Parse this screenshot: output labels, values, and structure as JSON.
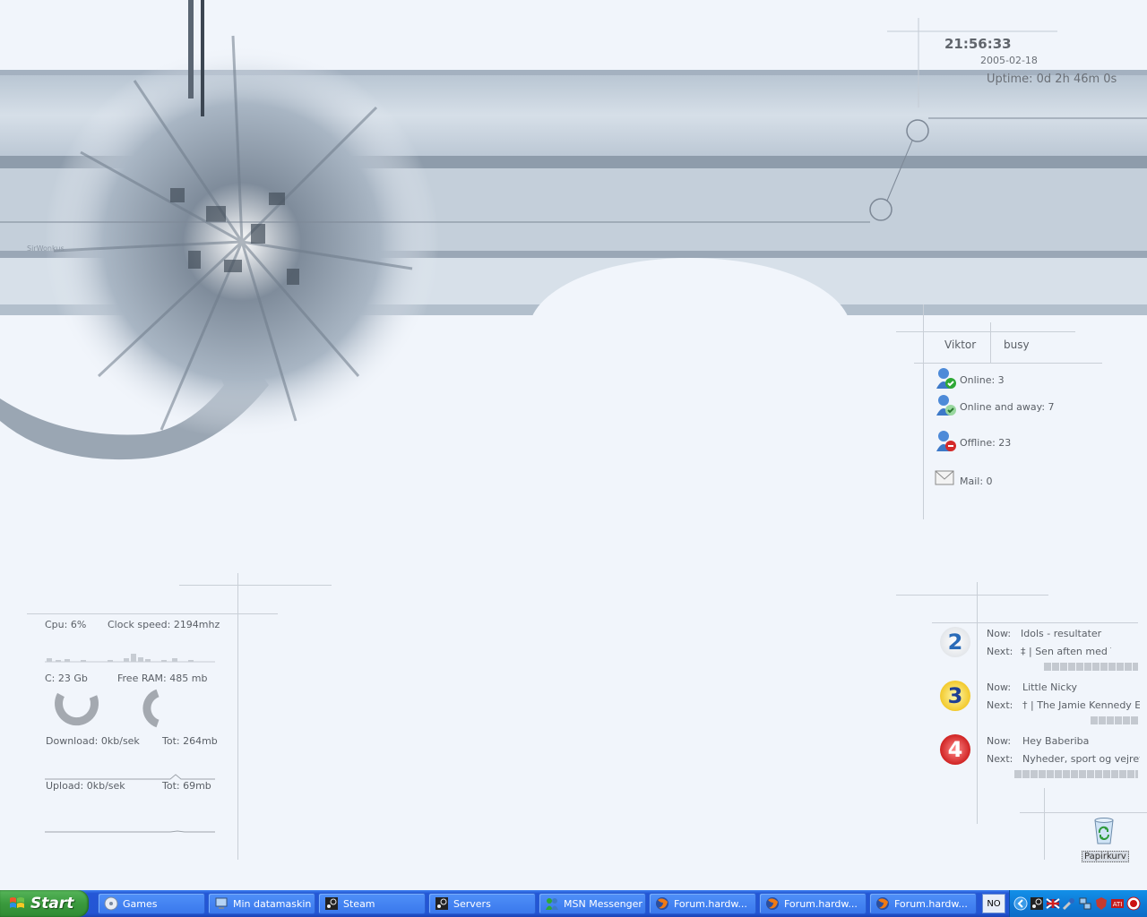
{
  "clock": {
    "time": "21:56:33",
    "date": "2005-02-18",
    "uptime": "Uptime: 0d 2h 46m 0s"
  },
  "wallpaper": {
    "signature": "SirWonkus"
  },
  "msn": {
    "user": "Viktor",
    "status": "busy",
    "online": "Online: 3",
    "online_away": "Online and away: 7",
    "offline": "Offline: 23",
    "mail": "Mail: 0"
  },
  "system": {
    "cpu": "Cpu: 6%",
    "clock_speed": "Clock speed: 2194mhz",
    "disk_c": "C: 23 Gb",
    "free_ram": "Free RAM: 485 mb",
    "download": "Download: 0kb/sek",
    "download_total": "Tot: 264mb",
    "upload": "Upload: 0kb/sek",
    "upload_total": "Tot: 69mb",
    "cpu_fraction": 0.06
  },
  "tv": {
    "now_label": "Now:",
    "next_label": "Next:",
    "channels": [
      {
        "number": "2",
        "now": "Idols - resultater",
        "next": "‡ | Sen aften med Th",
        "progress": 0.7,
        "color": "#2a6bb8"
      },
      {
        "number": "3",
        "now": "Little Nicky",
        "next": "† | The Jamie Kennedy Ex",
        "progress": 0.35,
        "color": "#1e3f93"
      },
      {
        "number": "4",
        "now": "Hey Baberiba",
        "next": "Nyheder, sport og vejret",
        "progress": 0.92,
        "color": "#d02323"
      }
    ]
  },
  "desktop_icons": {
    "recycle_bin": "Papirkurv"
  },
  "taskbar": {
    "start_label": "Start",
    "items": [
      {
        "label": "Games",
        "icon": "games-cd-icon"
      },
      {
        "label": "Min datamaskin",
        "icon": "my-computer-icon"
      },
      {
        "label": "Steam",
        "icon": "steam-icon"
      },
      {
        "label": "Servers",
        "icon": "steam-icon"
      },
      {
        "label": "MSN Messenger",
        "icon": "msn-icon"
      },
      {
        "label": "Forum.hardw...",
        "icon": "firefox-icon"
      },
      {
        "label": "Forum.hardw...",
        "icon": "firefox-icon"
      },
      {
        "label": "Forum.hardw...",
        "icon": "firefox-icon"
      }
    ],
    "language": "NO"
  },
  "colors": {
    "accent": "#2355d4",
    "start": "#3a9a3d",
    "tray": "#0f7bd7",
    "desktop": "#f1f5fb"
  }
}
